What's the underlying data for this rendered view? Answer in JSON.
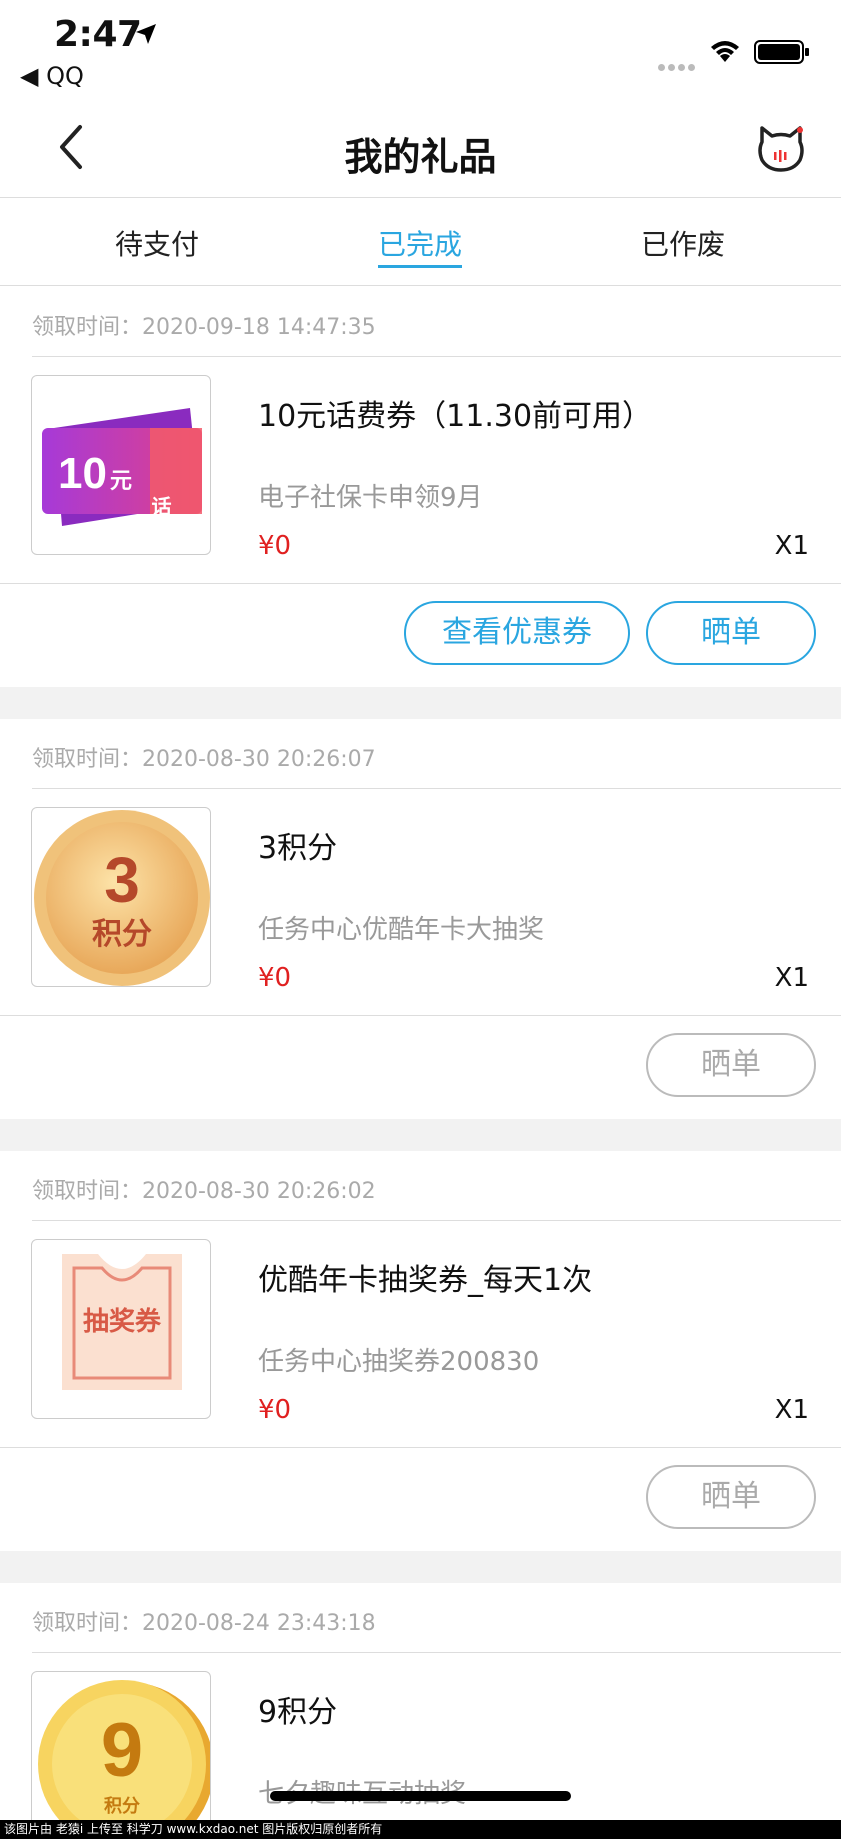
{
  "status": {
    "time": "2:47",
    "back_app": "◀ QQ"
  },
  "nav": {
    "title": "我的礼品"
  },
  "tabs": [
    {
      "label": "待支付",
      "active": false
    },
    {
      "label": "已完成",
      "active": true
    },
    {
      "label": "已作废",
      "active": false
    }
  ],
  "cards": [
    {
      "time": "领取时间：2020-09-18 14:47:35",
      "title": "10元话费券（11.30前可用）",
      "subtitle": "电子社保卡申领9月",
      "price": "¥0",
      "qty": "X1",
      "thumb_text_main": "10",
      "thumb_text_unit": "元",
      "thumb_text_side": "话费",
      "buttons": [
        "查看优惠券",
        "晒单"
      ]
    },
    {
      "time": "领取时间：2020-08-30 20:26:07",
      "title": "3积分",
      "subtitle": "任务中心优酷年卡大抽奖",
      "price": "¥0",
      "qty": "X1",
      "thumb_text_main": "3",
      "thumb_text_unit": "积分",
      "buttons": [
        "晒单"
      ]
    },
    {
      "time": "领取时间：2020-08-30 20:26:02",
      "title": "优酷年卡抽奖券_每天1次",
      "subtitle": "任务中心抽奖券200830",
      "price": "¥0",
      "qty": "X1",
      "thumb_text_main": "抽奖券",
      "buttons": [
        "晒单"
      ]
    },
    {
      "time": "领取时间：2020-08-24 23:43:18",
      "title": "9积分",
      "subtitle": "七夕趣味互动抽奖",
      "thumb_text_main": "9",
      "thumb_text_unit": "积分"
    }
  ],
  "footer": "该图片由 老猿i 上传至 科学刀 www.kxdao.net 图片版权归原创者所有",
  "colors": {
    "accent": "#2aa6e0",
    "price": "#e02020",
    "gap": "#f2f2f2"
  }
}
